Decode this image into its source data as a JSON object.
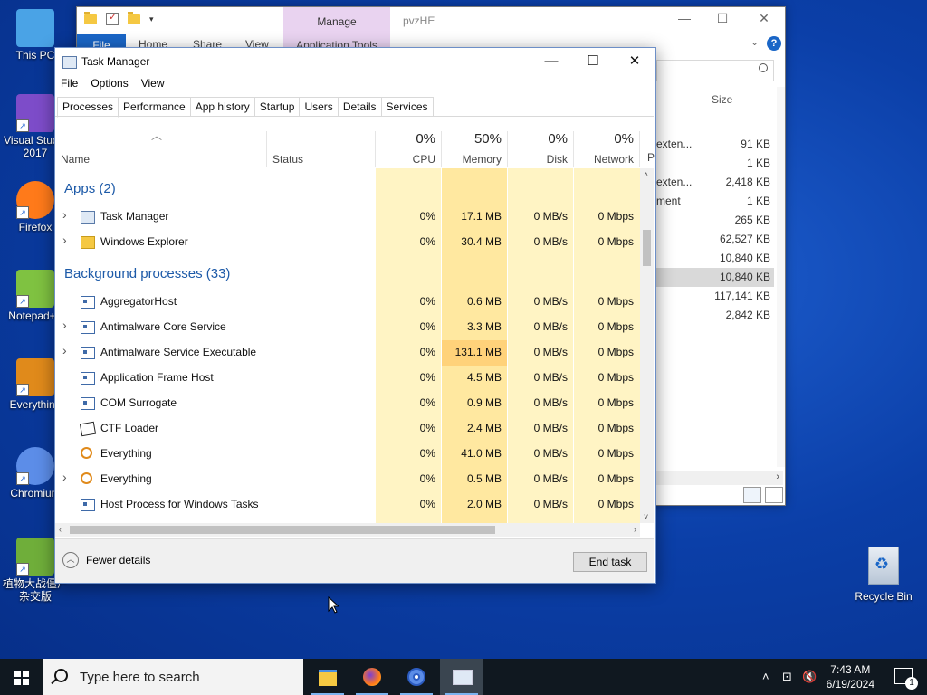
{
  "desktop": {
    "icons": [
      {
        "label": "This PC",
        "icon": "computer-icon"
      },
      {
        "label": "Visual Studio 2017",
        "icon": "visual-studio-icon"
      },
      {
        "label": "Firefox",
        "icon": "firefox-icon"
      },
      {
        "label": "Notepad++",
        "icon": "notepad-plus-plus-icon"
      },
      {
        "label": "Everything",
        "icon": "everything-search-icon"
      },
      {
        "label": "Chromium",
        "icon": "chromium-icon"
      },
      {
        "label": "植物大战僵尸杂交版",
        "icon": "plants-vs-zombies-icon"
      }
    ],
    "recycle_bin": "Recycle Bin"
  },
  "explorer": {
    "title": "pvzHE",
    "manage_label": "Manage",
    "ribbon_tabs": [
      "File",
      "Home",
      "Share",
      "View",
      "Application Tools"
    ],
    "size_header": "Size",
    "rows": [
      {
        "type": "extens",
        "size": "91 KB"
      },
      {
        "type": "",
        "size": "1 KB"
      },
      {
        "type": "extens",
        "size": "2,418 KB"
      },
      {
        "type": "ment",
        "size": "1 KB"
      },
      {
        "type": "",
        "size": "265 KB"
      },
      {
        "type": "",
        "size": "62,527 KB"
      },
      {
        "type": "",
        "size": "10,840 KB"
      },
      {
        "type": "",
        "size": "10,840 KB"
      },
      {
        "type": "",
        "size": "117,141 KB"
      },
      {
        "type": "",
        "size": "2,842 KB"
      }
    ],
    "row_type_prefix": [
      "exten...",
      "",
      "exten...",
      "ment",
      "",
      "",
      "",
      "",
      "",
      ""
    ]
  },
  "task_manager": {
    "title": "Task Manager",
    "menu": [
      "File",
      "Options",
      "View"
    ],
    "tabs": [
      "Processes",
      "Performance",
      "App history",
      "Startup",
      "Users",
      "Details",
      "Services"
    ],
    "active_tab": "Processes",
    "columns": {
      "name": "Name",
      "status": "Status",
      "cpu": {
        "pct": "0%",
        "label": "CPU"
      },
      "memory": {
        "pct": "50%",
        "label": "Memory"
      },
      "disk": {
        "pct": "0%",
        "label": "Disk"
      },
      "network": {
        "pct": "0%",
        "label": "Network"
      },
      "power_partial": "P"
    },
    "groups": {
      "apps": "Apps (2)",
      "background": "Background processes (33)"
    },
    "apps": [
      {
        "name": "Task Manager",
        "icon": "task-manager-icon",
        "expandable": true,
        "cpu": "0%",
        "memory": "17.1 MB",
        "disk": "0 MB/s",
        "network": "0 Mbps"
      },
      {
        "name": "Windows Explorer",
        "icon": "folder-icon",
        "expandable": true,
        "cpu": "0%",
        "memory": "30.4 MB",
        "disk": "0 MB/s",
        "network": "0 Mbps"
      }
    ],
    "background": [
      {
        "name": "AggregatorHost",
        "icon": "process-icon",
        "expandable": false,
        "cpu": "0%",
        "memory": "0.6 MB",
        "disk": "0 MB/s",
        "network": "0 Mbps"
      },
      {
        "name": "Antimalware Core Service",
        "icon": "process-icon",
        "expandable": true,
        "cpu": "0%",
        "memory": "3.3 MB",
        "disk": "0 MB/s",
        "network": "0 Mbps"
      },
      {
        "name": "Antimalware Service Executable",
        "icon": "process-icon",
        "expandable": true,
        "cpu": "0%",
        "memory": "131.1 MB",
        "disk": "0 MB/s",
        "network": "0 Mbps"
      },
      {
        "name": "Application Frame Host",
        "icon": "process-icon",
        "expandable": false,
        "cpu": "0%",
        "memory": "4.5 MB",
        "disk": "0 MB/s",
        "network": "0 Mbps"
      },
      {
        "name": "COM Surrogate",
        "icon": "process-icon",
        "expandable": false,
        "cpu": "0%",
        "memory": "0.9 MB",
        "disk": "0 MB/s",
        "network": "0 Mbps"
      },
      {
        "name": "CTF Loader",
        "icon": "ctf-loader-icon",
        "expandable": false,
        "cpu": "0%",
        "memory": "2.4 MB",
        "disk": "0 MB/s",
        "network": "0 Mbps"
      },
      {
        "name": "Everything",
        "icon": "everything-search-icon",
        "expandable": false,
        "cpu": "0%",
        "memory": "41.0 MB",
        "disk": "0 MB/s",
        "network": "0 Mbps"
      },
      {
        "name": "Everything",
        "icon": "everything-search-icon",
        "expandable": true,
        "cpu": "0%",
        "memory": "0.5 MB",
        "disk": "0 MB/s",
        "network": "0 Mbps"
      },
      {
        "name": "Host Process for Windows Tasks",
        "icon": "process-icon",
        "expandable": false,
        "cpu": "0%",
        "memory": "2.0 MB",
        "disk": "0 MB/s",
        "network": "0 Mbps"
      }
    ],
    "fewer_details": "Fewer details",
    "end_task": "End task"
  },
  "taskbar": {
    "search_placeholder": "Type here to search",
    "pinned": [
      "file-explorer-icon",
      "firefox-icon",
      "chromium-icon",
      "task-manager-icon"
    ],
    "time": "7:43 AM",
    "date": "6/19/2024",
    "notification_count": "1"
  },
  "colors": {
    "accent": "#1d5aa8",
    "heat_light": "#fff4c4",
    "heat_mid": "#ffe8a0",
    "heat_strong": "#ffd27a"
  }
}
